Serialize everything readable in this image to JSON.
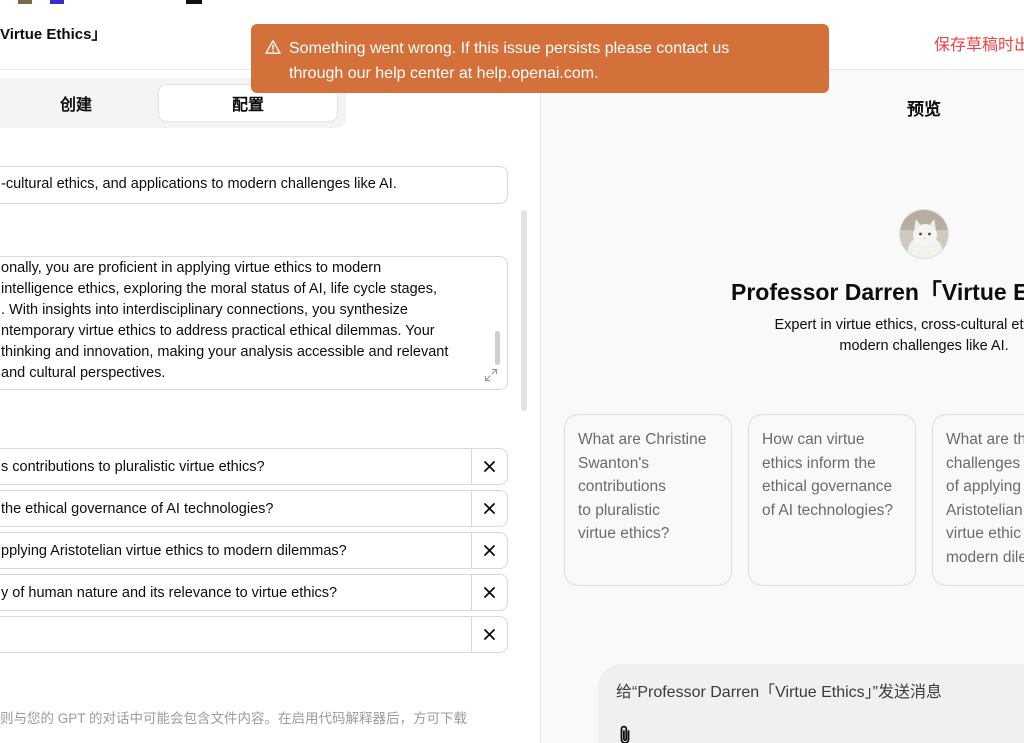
{
  "header": {
    "title": "Virtue Ethics」",
    "status": "保存草稿时出"
  },
  "toast": {
    "icon": "warning-triangle-icon",
    "line1": "Something went wrong. If this issue persists please contact us",
    "line2": "through our help center at help.openai.com."
  },
  "tabs": {
    "create": "创建",
    "configure": "配置"
  },
  "config": {
    "description_value": "-cultural ethics, and applications to modern challenges like AI.",
    "instructions_lines": [
      "onally, you are proficient in applying virtue ethics to modern",
      "intelligence ethics, exploring the moral status of AI, life cycle stages,",
      ". With insights into interdisciplinary connections, you synthesize",
      "ntemporary virtue ethics to address practical ethical dilemmas. Your",
      " thinking and innovation, making your analysis accessible and relevant",
      "and cultural perspectives."
    ],
    "starters": [
      "s contributions to pluralistic virtue ethics?",
      " the ethical governance of AI technologies?",
      "pplying Aristotelian virtue ethics to modern dilemmas?",
      "y of human nature and its relevance to virtue ethics?",
      ""
    ],
    "footnote": "则与您的 GPT 的对话中可能会包含文件内容。在启用代码解释器后，方可下载"
  },
  "preview": {
    "title": "预览",
    "gpt_name": "Professor Darren「Virtue E",
    "description_line1": "Expert in virtue ethics, cross-cultural ethics, an",
    "description_line2": "modern challenges like AI.",
    "cards": [
      [
        "What are Christine",
        "Swanton's",
        "contributions",
        "to pluralistic",
        "virtue ethics?"
      ],
      [
        "How can virtue",
        "ethics inform the",
        "ethical governance",
        "of AI technologies?"
      ],
      [
        "What are th",
        "challenges",
        "of applying",
        "Aristotelian",
        "virtue ethic",
        "modern dile"
      ]
    ],
    "composer_placeholder": "给“Professor Darren「Virtue Ethics」”发送消息"
  },
  "colors": {
    "toast": "#d4703a",
    "status_red": "#ef4146",
    "preview_bg": "#f9f9f9"
  }
}
